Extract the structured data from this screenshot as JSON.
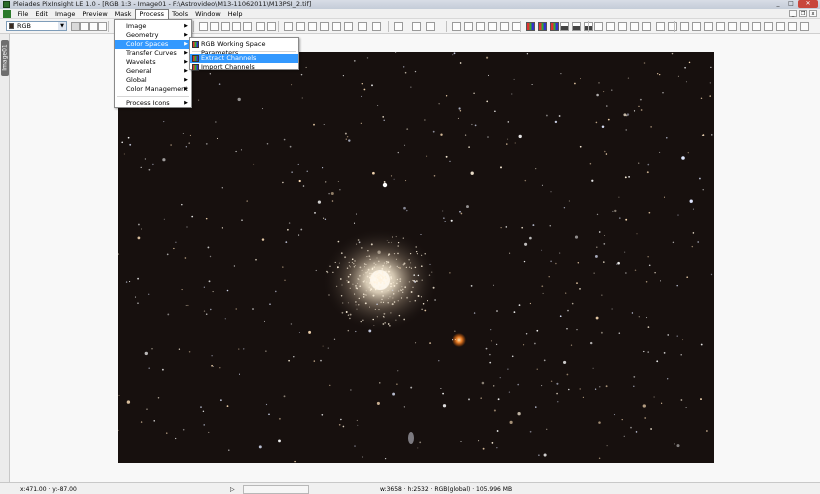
{
  "window": {
    "title": "Pleiades PixInsight LE 1.0 - [RGB 1:3 - Image01 - F:\\Astrovideo\\M13-11062011\\M13PSI_2.tif]"
  },
  "menubar": [
    "File",
    "Edit",
    "Image",
    "Preview",
    "Mask",
    "Process",
    "Tools",
    "Window",
    "Help"
  ],
  "toolbar": {
    "color_space_value": "RGB"
  },
  "image_tab": {
    "label": "Image01"
  },
  "process_menu": {
    "items": [
      "Image",
      "Geometry",
      "Color Spaces",
      "Transfer Curves",
      "Wavelets",
      "General",
      "Global",
      "Color Management",
      "Process Icons"
    ],
    "highlighted": "Color Spaces"
  },
  "color_spaces_submenu": {
    "items": [
      "RGB Working Space Parameters",
      "Extract Channels",
      "Import Channels"
    ],
    "highlighted": "Extract Channels"
  },
  "statusbar": {
    "cursor": "x:471.00 · y:-87.00",
    "image_info": "w:3658 · h:2532 · RGB(global) · 105.996 MB"
  },
  "colors": {
    "menu_highlight": "#3399ff",
    "image_background": "#17100e"
  }
}
